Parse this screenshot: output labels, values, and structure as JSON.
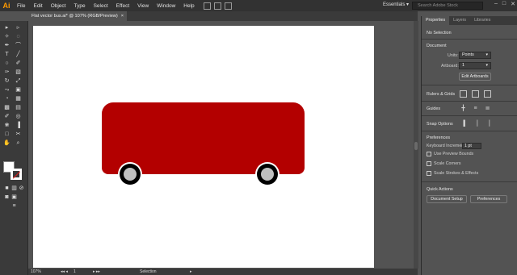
{
  "app": {
    "logo": "Ai"
  },
  "menu": [
    "File",
    "Edit",
    "Object",
    "Type",
    "Select",
    "Effect",
    "View",
    "Window",
    "Help"
  ],
  "workspace": {
    "label": "Essentials ▾"
  },
  "stock_search": {
    "placeholder": "Search Adobe Stock"
  },
  "window_controls": {
    "minimize": "–",
    "maximize": "□",
    "close": "✕"
  },
  "document_tab": {
    "title": "Flat vector bus.ai* @ 107% (RGB/Preview)",
    "close": "×"
  },
  "colors": {
    "bus_body": "#b30000",
    "accent": "#ff9a00"
  },
  "status_bar": {
    "zoom": "107%",
    "artboard": "1",
    "tool": "Selection"
  },
  "panel": {
    "tabs": [
      "Properties",
      "Layers",
      "Libraries"
    ],
    "selection": "No Selection",
    "document": {
      "title": "Document",
      "units_label": "Units:",
      "units_value": "Points",
      "artboard_label": "Artboard:",
      "artboard_value": "1",
      "edit_artboards": "Edit Artboards"
    },
    "ruler_grids": "Rulers & Grids",
    "guides": "Guides",
    "snap_options": "Snap Options",
    "preferences": {
      "title": "Preferences",
      "keyboard_increment_label": "Keyboard Increment:",
      "keyboard_increment_value": "1 pt",
      "use_preview_bounds": "Use Preview Bounds",
      "scale_corners": "Scale Corners",
      "scale_strokes": "Scale Strokes & Effects"
    },
    "quick_actions": {
      "title": "Quick Actions",
      "document_setup": "Document Setup",
      "preferences": "Preferences"
    }
  }
}
